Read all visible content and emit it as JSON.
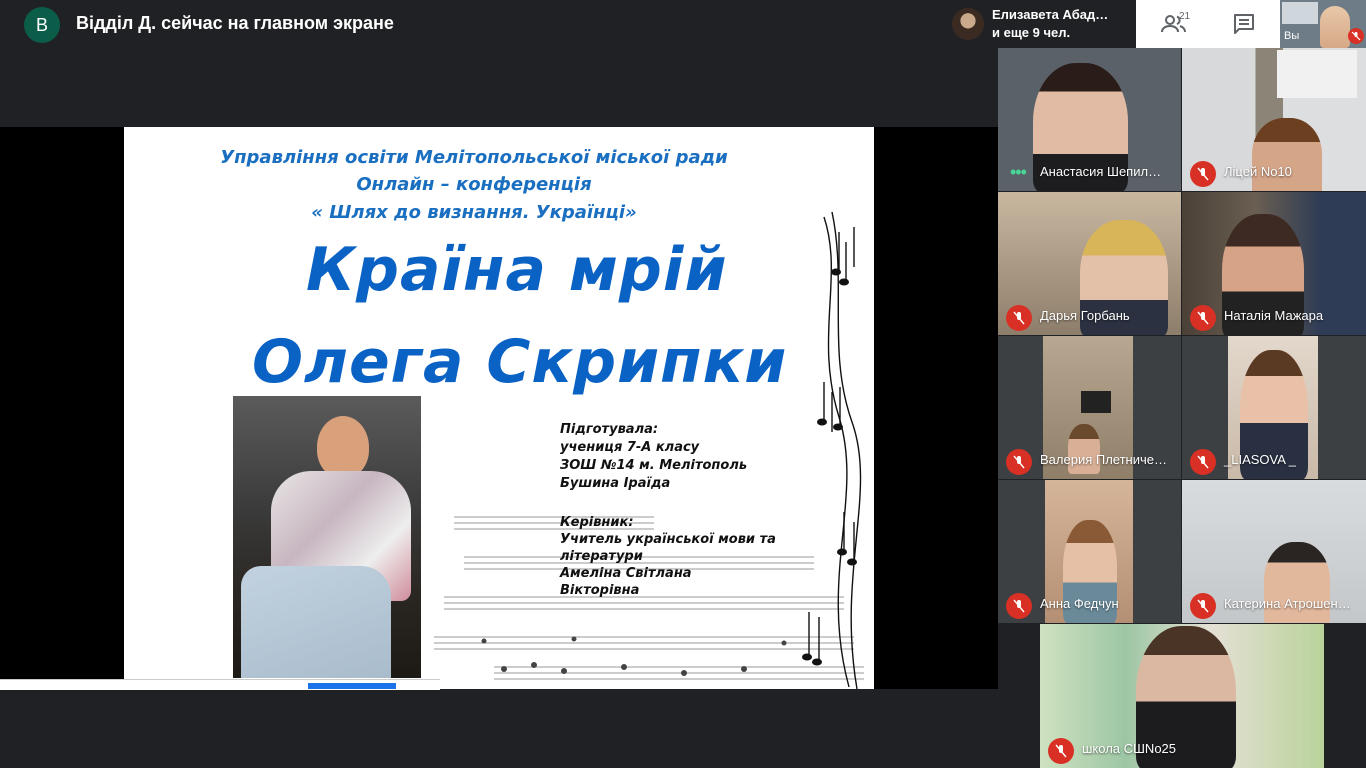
{
  "presenter": {
    "initial": "В",
    "status": "Відділ Д. сейчас на главном экране"
  },
  "active_speaker": {
    "line1": "Елизавета Абад…",
    "line2": "и еще 9 чел."
  },
  "controls": {
    "people_count": "21"
  },
  "self_view": {
    "label": "Вы"
  },
  "slide": {
    "header_lines": [
      "Управління освіти Мелітопольської міської ради",
      "Онлайн – конференція",
      "« Шлях до визнання. Українці»"
    ],
    "title_line1": "Країна мрій",
    "title_line2": "Олега Скрипки",
    "prepared_label": "Підготувала:",
    "prepared_lines": [
      "учениця 7-А класу",
      "ЗОШ №14 м. Мелітополь",
      "Бушина Іраїда"
    ],
    "supervisor_label": "Керівник:",
    "supervisor_lines": [
      "Учитель української мови та",
      "літератури",
      "Амеліна Світлана",
      "Вікторівна"
    ]
  },
  "participants": [
    {
      "name": "Анастасия Шепил…",
      "muted": false
    },
    {
      "name": "Ліцей No10",
      "muted": true
    },
    {
      "name": "Дарья Горбань",
      "muted": true
    },
    {
      "name": "Наталія Мажара",
      "muted": true
    },
    {
      "name": "Валерия Плетниче…",
      "muted": true
    },
    {
      "name": "_LIASOVA _",
      "muted": true
    },
    {
      "name": "Анна Федчун",
      "muted": true
    },
    {
      "name": "Катерина Атрошен…",
      "muted": true
    },
    {
      "name": "школа СШNo25",
      "muted": true
    }
  ],
  "colors": {
    "background": "#202124",
    "mute_red": "#d93025",
    "slide_blue": "#0a62c4",
    "speaking_green": "#48d597"
  }
}
